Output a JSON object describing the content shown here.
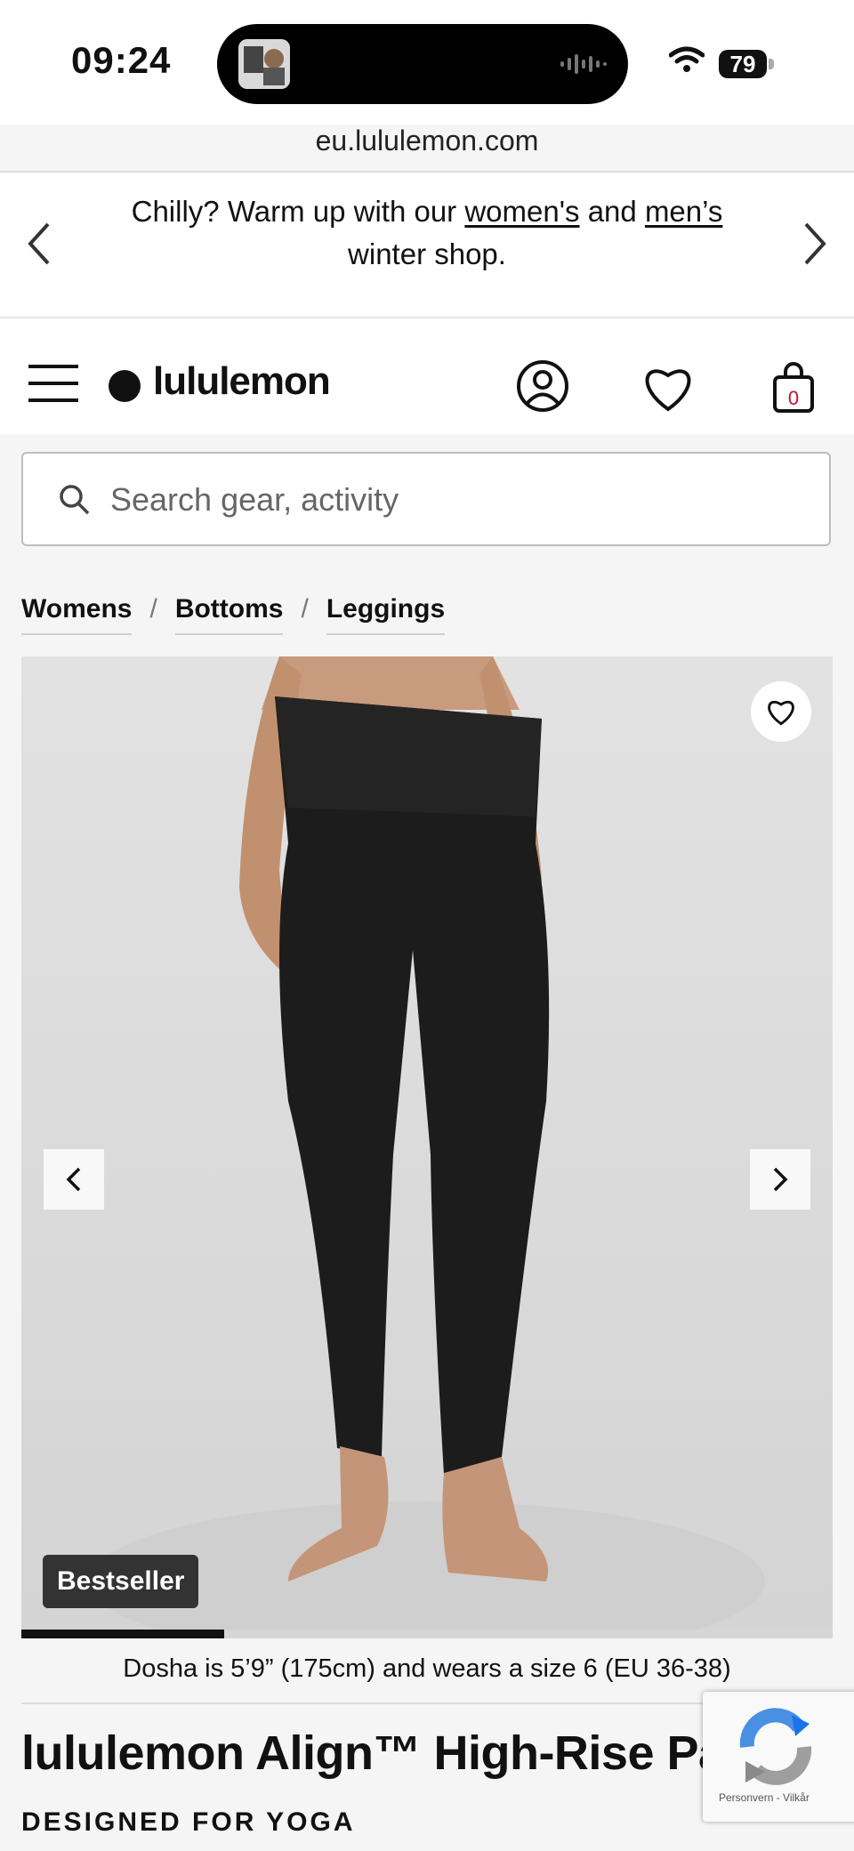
{
  "status_bar": {
    "time": "09:24",
    "battery": "79"
  },
  "browser": {
    "url": "eu.lululemon.com"
  },
  "promo": {
    "text_before": "Chilly? Warm up with our ",
    "link_women": "women's",
    "text_and": " and ",
    "link_men": "men’s",
    "text_after": " winter shop."
  },
  "header": {
    "logo": "lululemon",
    "cart_count": "0"
  },
  "search": {
    "placeholder": "Search gear, activity"
  },
  "breadcrumb": {
    "items": [
      "Womens",
      "Bottoms",
      "Leggings"
    ]
  },
  "gallery": {
    "badge": "Bestseller",
    "progress": 0.25
  },
  "product": {
    "model_caption": "Dosha is 5’9” (175cm) and wears a size 6 (EU 36-38)",
    "title": "lululemon Align™ High-Rise Pan",
    "subtitle": "DESIGNED FOR YOGA"
  },
  "recaptcha": {
    "links": "Personvern - Vilkår"
  },
  "colors": {
    "accent": "#111111",
    "cart_count": "#c8102e",
    "gallery_background": "#e6e6e6",
    "badge": "#333333"
  }
}
